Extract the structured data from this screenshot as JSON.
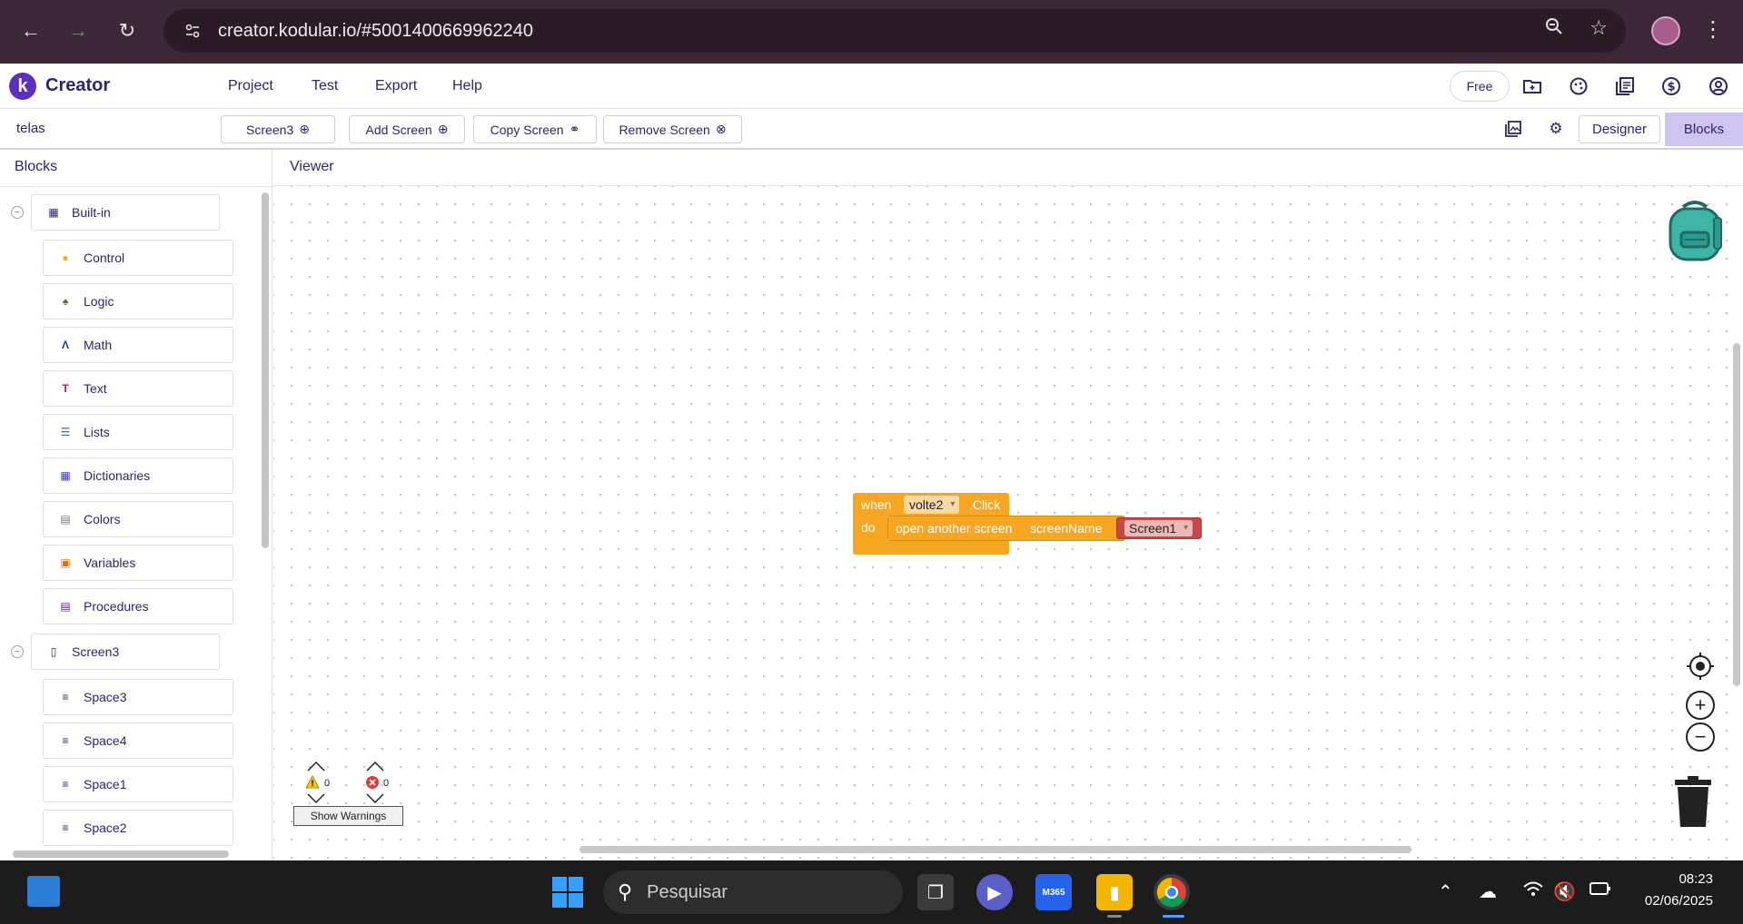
{
  "browser": {
    "url": "creator.kodular.io/#5001400669962240",
    "colors": {
      "frame": "#3c2838",
      "urlbar": "#2a1b27"
    }
  },
  "app": {
    "logo_letter": "k",
    "name": "Creator",
    "menu": [
      "Project",
      "Test",
      "Export",
      "Help"
    ],
    "plan_badge": "Free",
    "accent": "#5b2fbf"
  },
  "toolbar": {
    "project_name": "telas",
    "current_screen": "Screen3",
    "add_screen": "Add Screen",
    "copy_screen": "Copy Screen",
    "remove_screen": "Remove Screen",
    "designer": "Designer",
    "blocks": "Blocks"
  },
  "blocks_panel": {
    "title": "Blocks",
    "builtin": {
      "label": "Built-in",
      "items": [
        {
          "label": "Control",
          "icon": "control-icon",
          "color": "#f5a623"
        },
        {
          "label": "Logic",
          "icon": "logic-icon",
          "color": "#2e7d32"
        },
        {
          "label": "Math",
          "icon": "math-icon",
          "color": "#1e3a8a"
        },
        {
          "label": "Text",
          "icon": "text-icon",
          "color": "#c2185b"
        },
        {
          "label": "Lists",
          "icon": "lists-icon",
          "color": "#1976d2"
        },
        {
          "label": "Dictionaries",
          "icon": "dictionaries-icon",
          "color": "#3b3bc4"
        },
        {
          "label": "Colors",
          "icon": "colors-icon",
          "color": "#777777"
        },
        {
          "label": "Variables",
          "icon": "variables-icon",
          "color": "#ef6c00"
        },
        {
          "label": "Procedures",
          "icon": "procedures-icon",
          "color": "#6a1b9a"
        }
      ]
    },
    "screen": {
      "label": "Screen3",
      "items": [
        {
          "label": "Space3"
        },
        {
          "label": "Space4"
        },
        {
          "label": "Space1"
        },
        {
          "label": "Space2"
        }
      ]
    }
  },
  "viewer": {
    "title": "Viewer",
    "event_block": {
      "when": "when",
      "component": "volte2",
      "event": ".Click",
      "do": "do",
      "command": "open another screen",
      "param": "screenName",
      "value": "Screen1",
      "colors": {
        "event": "#f5a623",
        "value": "#c84848"
      }
    },
    "warnings": {
      "count": "0",
      "errors": "0",
      "button": "Show Warnings"
    }
  },
  "taskbar": {
    "search_placeholder": "Pesquisar",
    "time": "08:23",
    "date": "02/06/2025",
    "copilot_label": "M365"
  }
}
